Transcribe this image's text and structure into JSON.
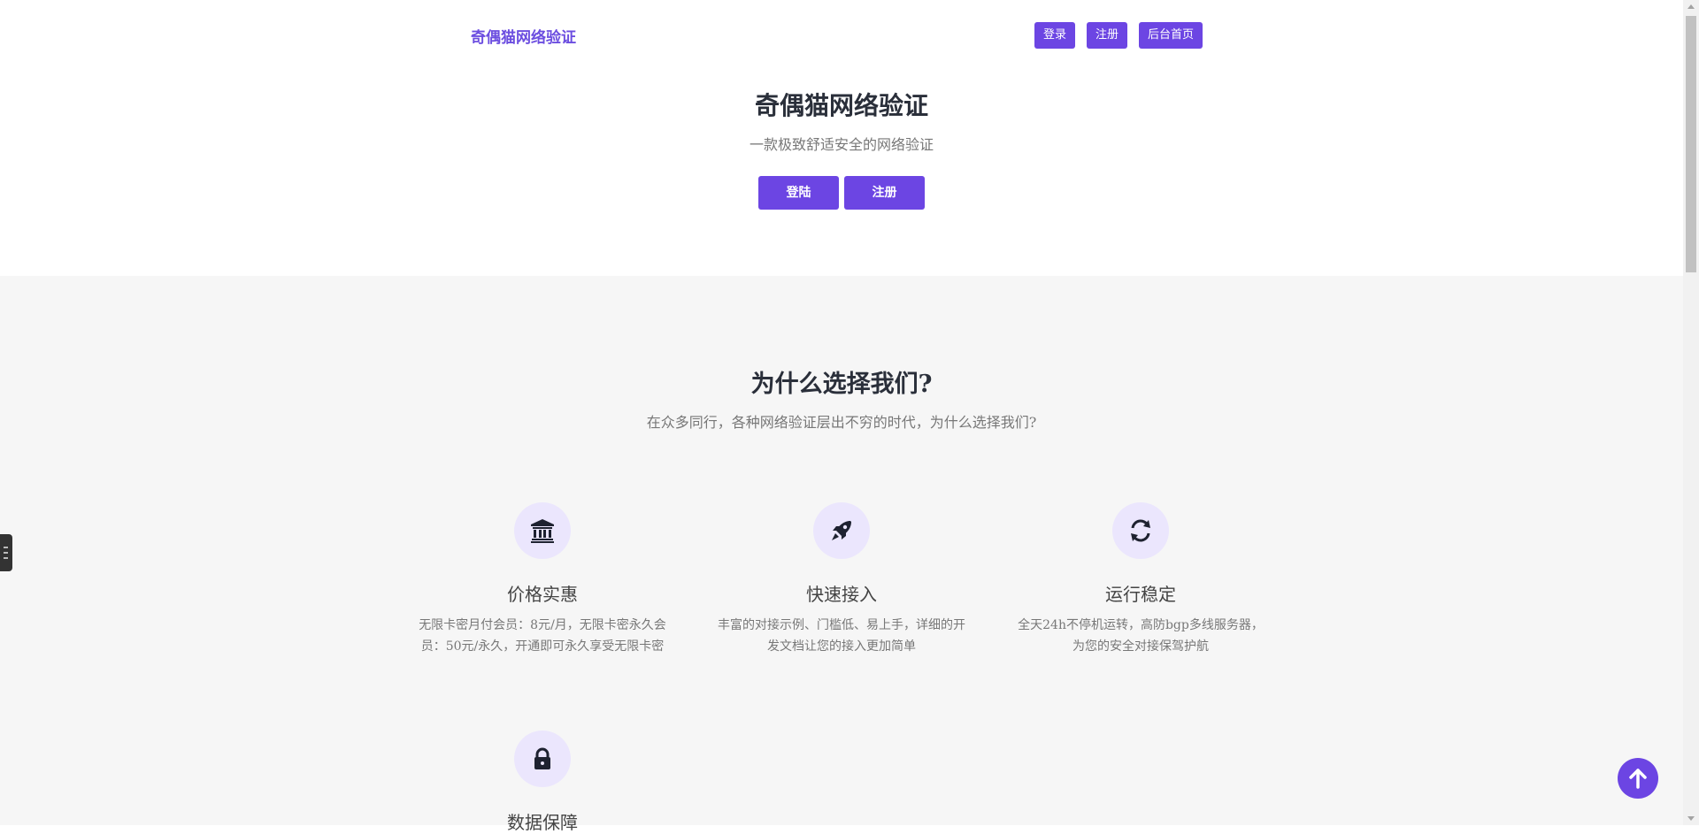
{
  "nav": {
    "brand": "奇偶猫网络验证",
    "buttons": [
      "登录",
      "注册",
      "后台首页"
    ]
  },
  "hero": {
    "title": "奇偶猫网络验证",
    "subtitle": "一款极致舒适安全的网络验证",
    "login_label": "登陆",
    "register_label": "注册"
  },
  "why": {
    "title": "为什么选择我们?",
    "subtitle": "在众多同行，各种网络验证层出不穷的时代，为什么选择我们?",
    "features": [
      {
        "icon": "bank-icon",
        "title": "价格实惠",
        "desc": "无限卡密月付会员：8元/月，无限卡密永久会员：50元/永久，开通即可永久享受无限卡密"
      },
      {
        "icon": "rocket-icon",
        "title": "快速接入",
        "desc": "丰富的对接示例、门槛低、易上手，详细的开发文档让您的接入更加简单"
      },
      {
        "icon": "refresh-icon",
        "title": "运行稳定",
        "desc": "全天24h不停机运转，高防bgp多线服务器，为您的安全对接保驾护航"
      },
      {
        "icon": "lock-icon",
        "title": "数据保障",
        "desc": ""
      }
    ]
  },
  "colors": {
    "accent": "#6c45e3",
    "icon_bg": "#ebe6fd",
    "section_bg": "#f6f6f6"
  }
}
